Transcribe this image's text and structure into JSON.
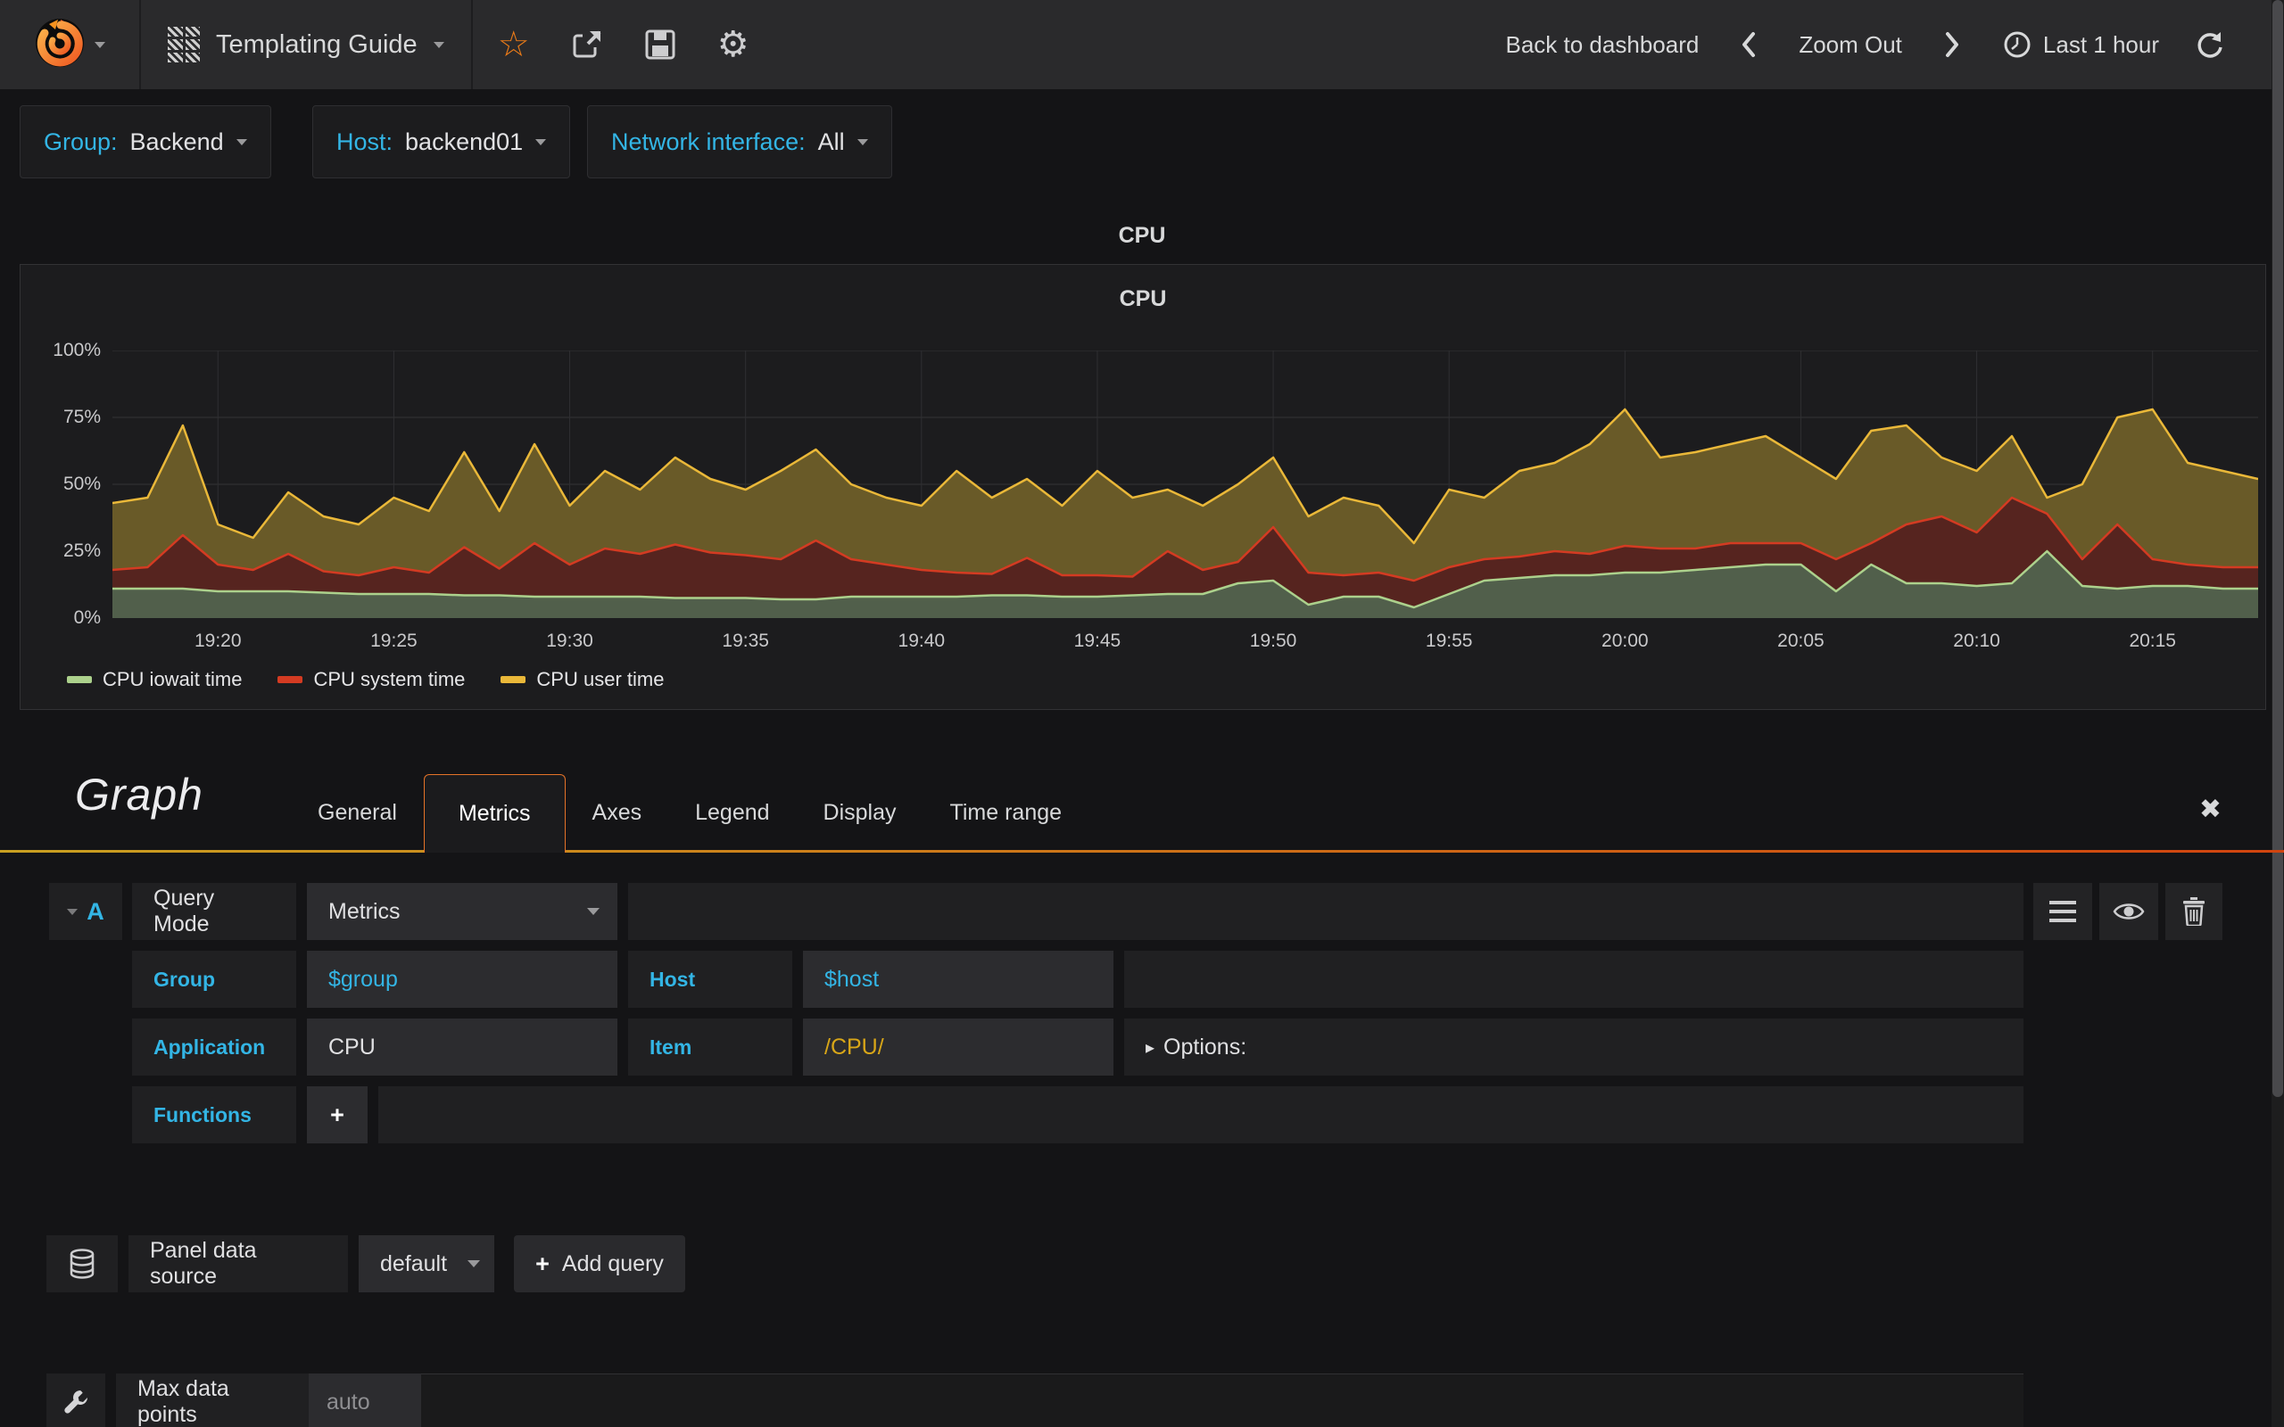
{
  "icons": {
    "star": "☆",
    "gear": "⚙",
    "close": "✖",
    "options_caret": "▸",
    "plus": "+"
  },
  "navbar": {
    "title": "Templating Guide",
    "back_to_dashboard": "Back to dashboard",
    "zoom_out": "Zoom Out",
    "time_range": "Last 1 hour"
  },
  "variables": [
    {
      "label": "Group:",
      "value": "Backend"
    },
    {
      "label": "Host:",
      "value": "backend01"
    },
    {
      "label": "Network interface:",
      "value": "All"
    }
  ],
  "dashboard_row_title": "CPU",
  "chart_data": {
    "type": "area",
    "stacked": true,
    "title": "CPU",
    "ylabel": "percent",
    "ylim": [
      0,
      100
    ],
    "ytick_labels": [
      "0%",
      "25%",
      "50%",
      "75%",
      "100%"
    ],
    "x_start_min": 1157,
    "x_tick_start_min": 1160,
    "x_tick_step_min": 5,
    "x_tick_labels": [
      "19:20",
      "19:25",
      "19:30",
      "19:35",
      "19:40",
      "19:45",
      "19:50",
      "19:55",
      "20:00",
      "20:05",
      "20:10",
      "20:15"
    ],
    "legend_position": "bottom-left",
    "grid": true,
    "legend": [
      "CPU iowait time",
      "CPU system time",
      "CPU user time"
    ],
    "series": [
      {
        "name": "CPU iowait time",
        "color": "#ACD18C",
        "fill": "#515F4B",
        "values": [
          11,
          11,
          11,
          10,
          10,
          10,
          9.5,
          9,
          9,
          9,
          8.5,
          8.5,
          8,
          8,
          8,
          8,
          7.5,
          7.5,
          7.5,
          7,
          7,
          8,
          8,
          8,
          8,
          8.5,
          8.5,
          8,
          8,
          8.5,
          9,
          9,
          13,
          14,
          5,
          8,
          8,
          4,
          9,
          14,
          15,
          16,
          16,
          17,
          17,
          18,
          19,
          20,
          20,
          10,
          20,
          13,
          13,
          12,
          13,
          25,
          12,
          11,
          12,
          12,
          11,
          11
        ]
      },
      {
        "name": "CPU system time",
        "color": "#D43B22",
        "fill": "#56241F",
        "values": [
          7,
          8,
          20,
          10,
          8,
          14,
          8,
          7,
          10,
          8,
          18,
          10,
          20,
          12,
          18,
          16,
          20,
          17,
          16,
          15,
          22,
          14,
          12,
          10,
          9,
          8,
          14,
          8,
          8,
          7,
          16,
          9,
          8,
          20,
          12,
          8,
          9,
          10,
          10,
          8,
          8,
          9,
          8,
          10,
          9,
          8,
          9,
          8,
          8,
          12,
          8,
          22,
          25,
          20,
          32,
          14,
          10,
          24,
          10,
          8,
          8,
          8
        ]
      },
      {
        "name": "CPU user time",
        "color": "#EAB839",
        "fill": "#695A28",
        "values": [
          25,
          26,
          41,
          15,
          12,
          23,
          20.5,
          19,
          26,
          23,
          35.5,
          21.5,
          37,
          22,
          29,
          24,
          32.5,
          27.5,
          24.5,
          33,
          34,
          28,
          25,
          24,
          38,
          28.5,
          29.5,
          26,
          39,
          29.5,
          23,
          24,
          29,
          26,
          21,
          29,
          25,
          14,
          29,
          23,
          32,
          33,
          41,
          51,
          34,
          36,
          37,
          40,
          32,
          30,
          42,
          37,
          22,
          23,
          23,
          6,
          28,
          40,
          56,
          38,
          36,
          33
        ]
      }
    ]
  },
  "editor": {
    "panel_type": "Graph",
    "tabs": [
      "General",
      "Metrics",
      "Axes",
      "Legend",
      "Display",
      "Time range"
    ],
    "active_tab": "Metrics",
    "query": {
      "ref": "A",
      "mode_label": "Query Mode",
      "mode_value": "Metrics",
      "group_label": "Group",
      "group_value": "$group",
      "host_label": "Host",
      "host_value": "$host",
      "application_label": "Application",
      "application_value": "CPU",
      "item_label": "Item",
      "item_value": "/CPU/",
      "options_label": "Options:",
      "functions_label": "Functions"
    },
    "datasource": {
      "label": "Panel data source",
      "value": "default",
      "add_query_label": "Add query"
    },
    "settings": {
      "max_data_points_label": "Max data points",
      "max_data_points_placeholder": "auto"
    }
  }
}
